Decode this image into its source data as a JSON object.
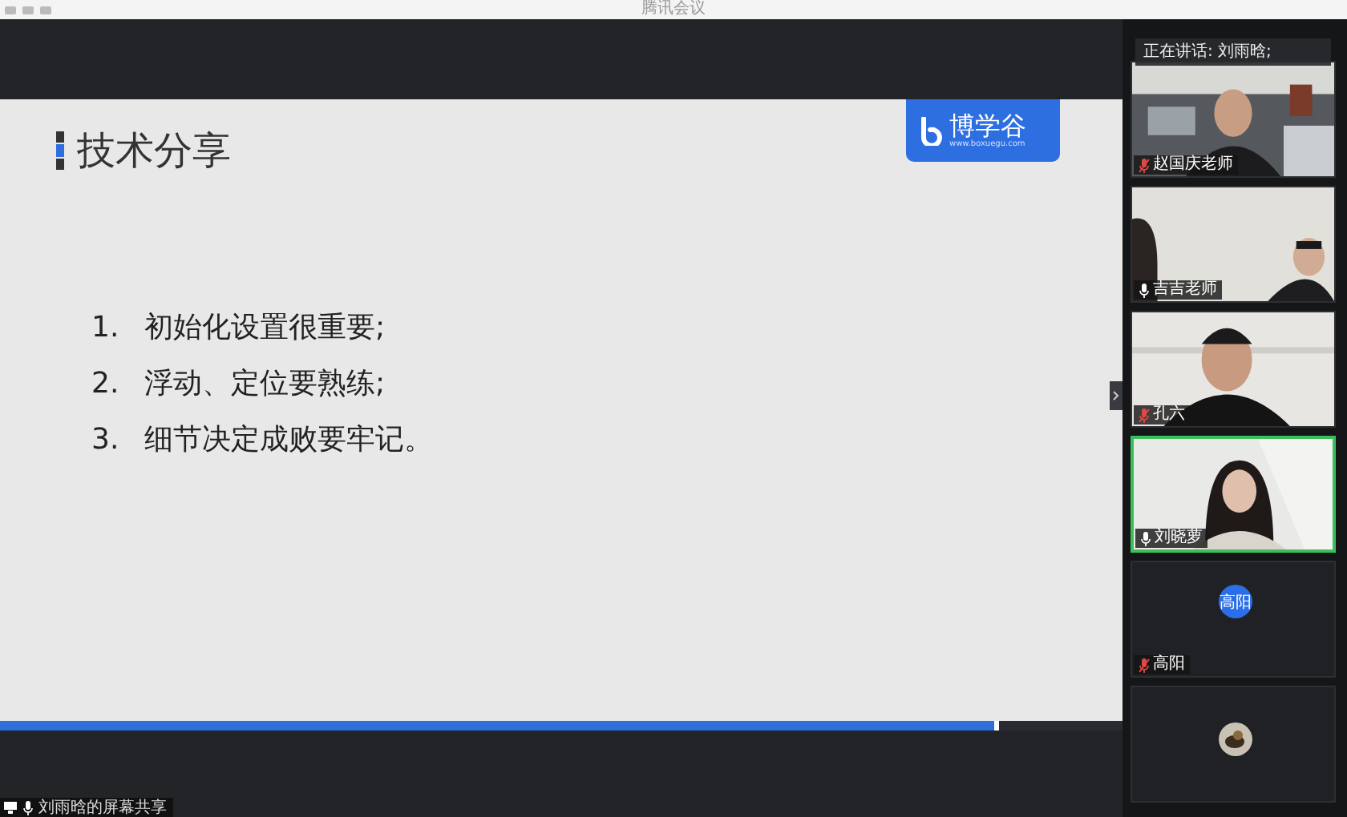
{
  "window": {
    "title": "腾讯会议"
  },
  "slide": {
    "title": "技术分享",
    "logo": {
      "name": "博学谷",
      "url": "www.boxuegu.com"
    },
    "items": [
      {
        "number": "1.",
        "text": "初始化设置很重要;"
      },
      {
        "number": "2.",
        "text": "浮动、定位要熟练;"
      },
      {
        "number": "3.",
        "text": "细节决定成败要牢记。"
      }
    ]
  },
  "share_progress": {
    "level": 0.89
  },
  "share_label": "刘雨晗的屏幕共享",
  "speaking_banner": "正在讲话: 刘雨晗;",
  "participants": [
    {
      "name": "赵国庆老师",
      "kind": "video",
      "muted": true,
      "active": false
    },
    {
      "name": "吉吉老师",
      "kind": "video",
      "muted": false,
      "active": false
    },
    {
      "name": "孔六",
      "kind": "video",
      "muted": true,
      "active": false
    },
    {
      "name": "刘晓萝",
      "kind": "video",
      "muted": false,
      "active": true
    },
    {
      "name": "高阳",
      "kind": "avatar",
      "avatar_text": "高阳",
      "muted": true,
      "active": false
    },
    {
      "kind": "photo-avatar"
    }
  ]
}
